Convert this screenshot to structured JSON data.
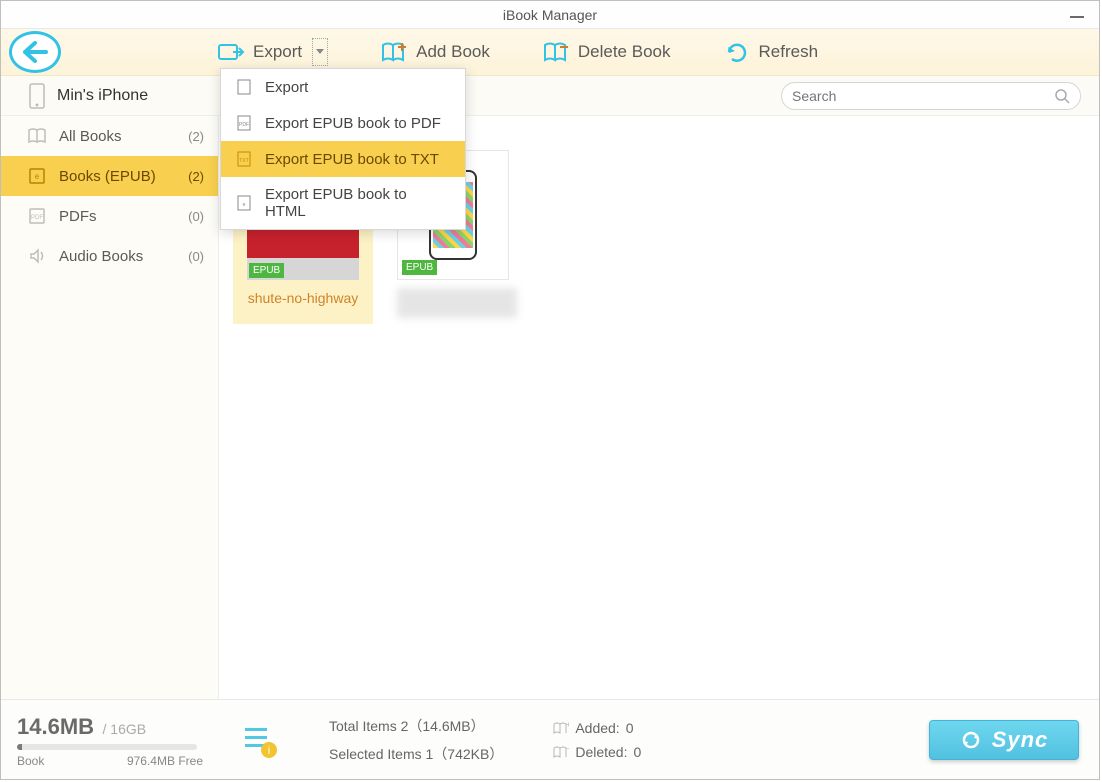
{
  "window": {
    "title": "iBook Manager"
  },
  "toolbar": {
    "export_label": "Export",
    "add_label": "Add Book",
    "delete_label": "Delete Book",
    "refresh_label": "Refresh"
  },
  "export_menu": {
    "items": [
      {
        "label": "Export"
      },
      {
        "label": "Export EPUB book to PDF"
      },
      {
        "label": "Export EPUB book to TXT"
      },
      {
        "label": "Export EPUB book to HTML"
      }
    ],
    "highlighted_index": 2
  },
  "device": {
    "name": "Min's iPhone"
  },
  "search": {
    "placeholder": "Search"
  },
  "sidebar": {
    "items": [
      {
        "label": "All Books",
        "count": "(2)"
      },
      {
        "label": "Books (EPUB)",
        "count": "(2)"
      },
      {
        "label": "PDFs",
        "count": "(0)"
      },
      {
        "label": "Audio Books",
        "count": "(0)"
      }
    ],
    "active_index": 1
  },
  "books": {
    "epub_badge": "EPUB",
    "items": [
      {
        "title": "shute-no-highway"
      },
      {
        "title": ""
      }
    ],
    "selected_index": 0
  },
  "footer": {
    "used": "14.6MB",
    "capacity": "16GB",
    "category": "Book",
    "free": "976.4MB Free",
    "total_label": "Total Items",
    "total_value": "2（14.6MB）",
    "selected_label": "Selected Items",
    "selected_value": "1（742KB）",
    "added_label": "Added:",
    "added_value": "0",
    "deleted_label": "Deleted:",
    "deleted_value": "0",
    "sync_label": "Sync"
  },
  "colors": {
    "accent_cyan": "#32c2e6",
    "highlight_yellow": "#f8cf4f"
  }
}
